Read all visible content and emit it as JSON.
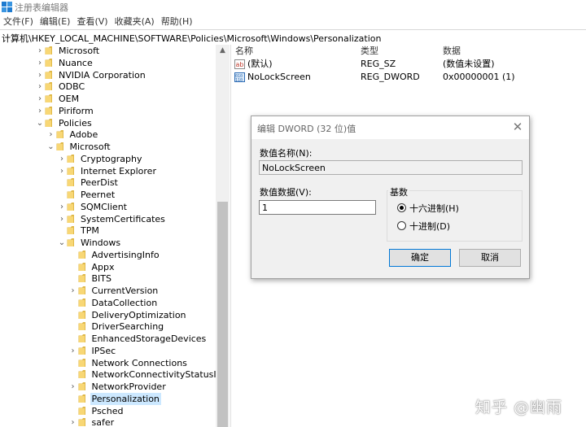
{
  "window": {
    "title": "注册表编辑器"
  },
  "menu": [
    "文件(F)",
    "编辑(E)",
    "查看(V)",
    "收藏夹(A)",
    "帮助(H)"
  ],
  "address": "计算机\\HKEY_LOCAL_MACHINE\\SOFTWARE\\Policies\\Microsoft\\Windows\\Personalization",
  "tree": [
    {
      "label": "Microsoft",
      "arrow": "›",
      "level": 0
    },
    {
      "label": "Nuance",
      "arrow": "›",
      "level": 0
    },
    {
      "label": "NVIDIA Corporation",
      "arrow": "›",
      "level": 0
    },
    {
      "label": "ODBC",
      "arrow": "›",
      "level": 0
    },
    {
      "label": "OEM",
      "arrow": "›",
      "level": 0
    },
    {
      "label": "Piriform",
      "arrow": "›",
      "level": 0
    },
    {
      "label": "Policies",
      "arrow": "⌄",
      "level": 0
    },
    {
      "label": "Adobe",
      "arrow": "›",
      "level": 1
    },
    {
      "label": "Microsoft",
      "arrow": "⌄",
      "level": 1
    },
    {
      "label": "Cryptography",
      "arrow": "›",
      "level": 2
    },
    {
      "label": "Internet Explorer",
      "arrow": "›",
      "level": 2
    },
    {
      "label": "PeerDist",
      "arrow": "",
      "level": 2
    },
    {
      "label": "Peernet",
      "arrow": "",
      "level": 2
    },
    {
      "label": "SQMClient",
      "arrow": "›",
      "level": 2
    },
    {
      "label": "SystemCertificates",
      "arrow": "›",
      "level": 2
    },
    {
      "label": "TPM",
      "arrow": "",
      "level": 2
    },
    {
      "label": "Windows",
      "arrow": "⌄",
      "level": 2
    },
    {
      "label": "AdvertisingInfo",
      "arrow": "",
      "level": 3
    },
    {
      "label": "Appx",
      "arrow": "",
      "level": 3
    },
    {
      "label": "BITS",
      "arrow": "",
      "level": 3
    },
    {
      "label": "CurrentVersion",
      "arrow": "›",
      "level": 3
    },
    {
      "label": "DataCollection",
      "arrow": "",
      "level": 3
    },
    {
      "label": "DeliveryOptimization",
      "arrow": "",
      "level": 3
    },
    {
      "label": "DriverSearching",
      "arrow": "",
      "level": 3
    },
    {
      "label": "EnhancedStorageDevices",
      "arrow": "",
      "level": 3
    },
    {
      "label": "IPSec",
      "arrow": "›",
      "level": 3
    },
    {
      "label": "Network Connections",
      "arrow": "",
      "level": 3
    },
    {
      "label": "NetworkConnectivityStatusIndi",
      "arrow": "",
      "level": 3
    },
    {
      "label": "NetworkProvider",
      "arrow": "›",
      "level": 3
    },
    {
      "label": "Personalization",
      "arrow": "",
      "level": 3,
      "selected": true
    },
    {
      "label": "Psched",
      "arrow": "",
      "level": 3
    },
    {
      "label": "safer",
      "arrow": "›",
      "level": 3
    }
  ],
  "values": {
    "headers": {
      "name": "名称",
      "type": "类型",
      "data": "数据"
    },
    "rows": [
      {
        "name": "(默认)",
        "type": "REG_SZ",
        "data": "(数值未设置)",
        "icon": "string-value-icon"
      },
      {
        "name": "NoLockScreen",
        "type": "REG_DWORD",
        "data": "0x00000001 (1)",
        "icon": "dword-value-icon"
      }
    ]
  },
  "dialog": {
    "title": "编辑 DWORD (32 位)值",
    "name_label": "数值名称(N):",
    "name_value": "NoLockScreen",
    "data_label": "数值数据(V):",
    "data_value": "1",
    "base_label": "基数",
    "hex_label": "十六进制(H)",
    "dec_label": "十进制(D)",
    "base_selected": "hex",
    "ok_label": "确定",
    "cancel_label": "取消"
  },
  "watermark": "知乎 @幽雨",
  "colors": {
    "selection": "#cce8ff",
    "folder": "#f8d775",
    "default_button_border": "#0078d7"
  }
}
